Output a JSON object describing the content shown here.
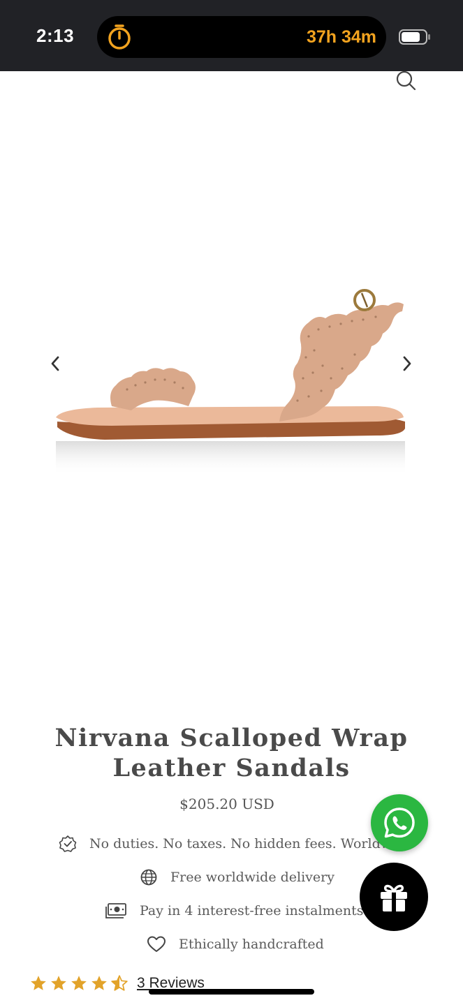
{
  "status_bar": {
    "time": "2:13",
    "timer": "37h 34m",
    "accent_color": "#f2a31f",
    "icons": [
      "timer-icon",
      "battery-icon"
    ]
  },
  "header": {
    "icons": [
      "search-icon"
    ]
  },
  "gallery": {
    "icons": [
      "chevron-left-icon",
      "chevron-right-icon"
    ]
  },
  "product": {
    "title": "Nirvana Scalloped Wrap Leather Sandals",
    "price": "$205.20 USD"
  },
  "features": [
    {
      "icon": "verified-badge-icon",
      "text": "No duties. No taxes. No hidden fees. Worldw"
    },
    {
      "icon": "globe-icon",
      "text": "Free worldwide delivery"
    },
    {
      "icon": "cash-icon",
      "text": "Pay in 4 interest-free instalments"
    },
    {
      "icon": "heart-icon",
      "text": "Ethically handcrafted"
    }
  ],
  "reviews": {
    "rating": 4.5,
    "max_rating": 5,
    "label": "3 Reviews",
    "star_color": "#e2a32a"
  },
  "floating": {
    "whatsapp_color": "#2bb741",
    "icons": [
      "whatsapp-icon",
      "gift-icon"
    ]
  }
}
